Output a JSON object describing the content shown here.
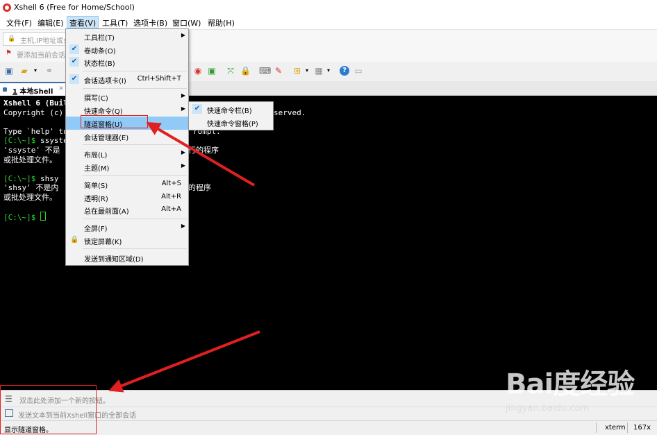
{
  "window": {
    "title": "Xshell 6 (Free for Home/School)"
  },
  "menubar": {
    "items": [
      "文件(F)",
      "编辑(E)",
      "查看(V)",
      "工具(T)",
      "选项卡(B)",
      "窗口(W)",
      "帮助(H)"
    ],
    "active": "查看(V)"
  },
  "address": {
    "placeholder": "主机,IP地址或会",
    "link_placeholder": "要添加当前会话"
  },
  "tabs": [
    {
      "index": "1",
      "label": "本地Shell",
      "close": "×"
    }
  ],
  "terminal": {
    "lines": [
      "Xshell 6 (Buil",
      "Copyright (c)",
      "",
      "Type `help' to",
      "",
      "'ssyste' 不是",
      "或批处理文件。",
      "",
      "",
      "'shsy' 不是内",
      "或批处理文件。"
    ],
    "prompt1": "[C:\\~]$",
    "cmd1": " ssyste",
    "prompt2": "[C:\\~]$",
    "cmd2": " shsy",
    "prompt3": "[C:\\~]$",
    "right_frag1": "served.",
    "right_frag2": "rompt.",
    "right_frag3": "行的程序",
    "right_frag4": "的程序"
  },
  "view_menu": {
    "items": [
      {
        "label": "工具栏(T)",
        "arrow": "▶"
      },
      {
        "label": "卷动条(O)",
        "checked": "✔"
      },
      {
        "label": "状态栏(B)",
        "checked": "✔"
      },
      {
        "label": "会话选项卡(I)",
        "checked": "✔",
        "shortcut": "Ctrl+Shift+T"
      },
      {
        "label": "撰写(C)",
        "arrow": "▶"
      },
      {
        "label": "快速命令(Q)",
        "arrow": "▶"
      },
      {
        "label": "隧道窗格(U)"
      },
      {
        "label": "会话管理器(E)"
      },
      {
        "label": "布局(L)",
        "arrow": "▶"
      },
      {
        "label": "主题(M)",
        "arrow": "▶"
      },
      {
        "label": "简单(S)",
        "shortcut": "Alt+S"
      },
      {
        "label": "透明(R)",
        "shortcut": "Alt+R"
      },
      {
        "label": "总在最前面(A)",
        "shortcut": "Alt+A"
      },
      {
        "label": "全屏(F)",
        "arrow": "▶"
      },
      {
        "label": "锁定屏幕(K)"
      },
      {
        "label": "发送到通知区域(D)"
      }
    ]
  },
  "quick_submenu": {
    "items": [
      {
        "label": "快速命令栏(B)",
        "checked": "✔"
      },
      {
        "label": "快速命令窗格(P)"
      }
    ]
  },
  "quick_bar": {
    "text": "双击此处添加一个新的按钮。"
  },
  "compose_bar": {
    "text": "发送文本到当前Xshell窗口的全部会话"
  },
  "status_bar": {
    "text": "显示隧道窗格。",
    "term": "xterm",
    "size": "167x"
  },
  "watermark": {
    "brand": "Bai度经验",
    "url": "jingyan.baidu.com"
  },
  "colors": {
    "prompt_green": "#2cd52c",
    "annotation_red": "#e02020",
    "menu_highlight": "#91c9f7"
  }
}
